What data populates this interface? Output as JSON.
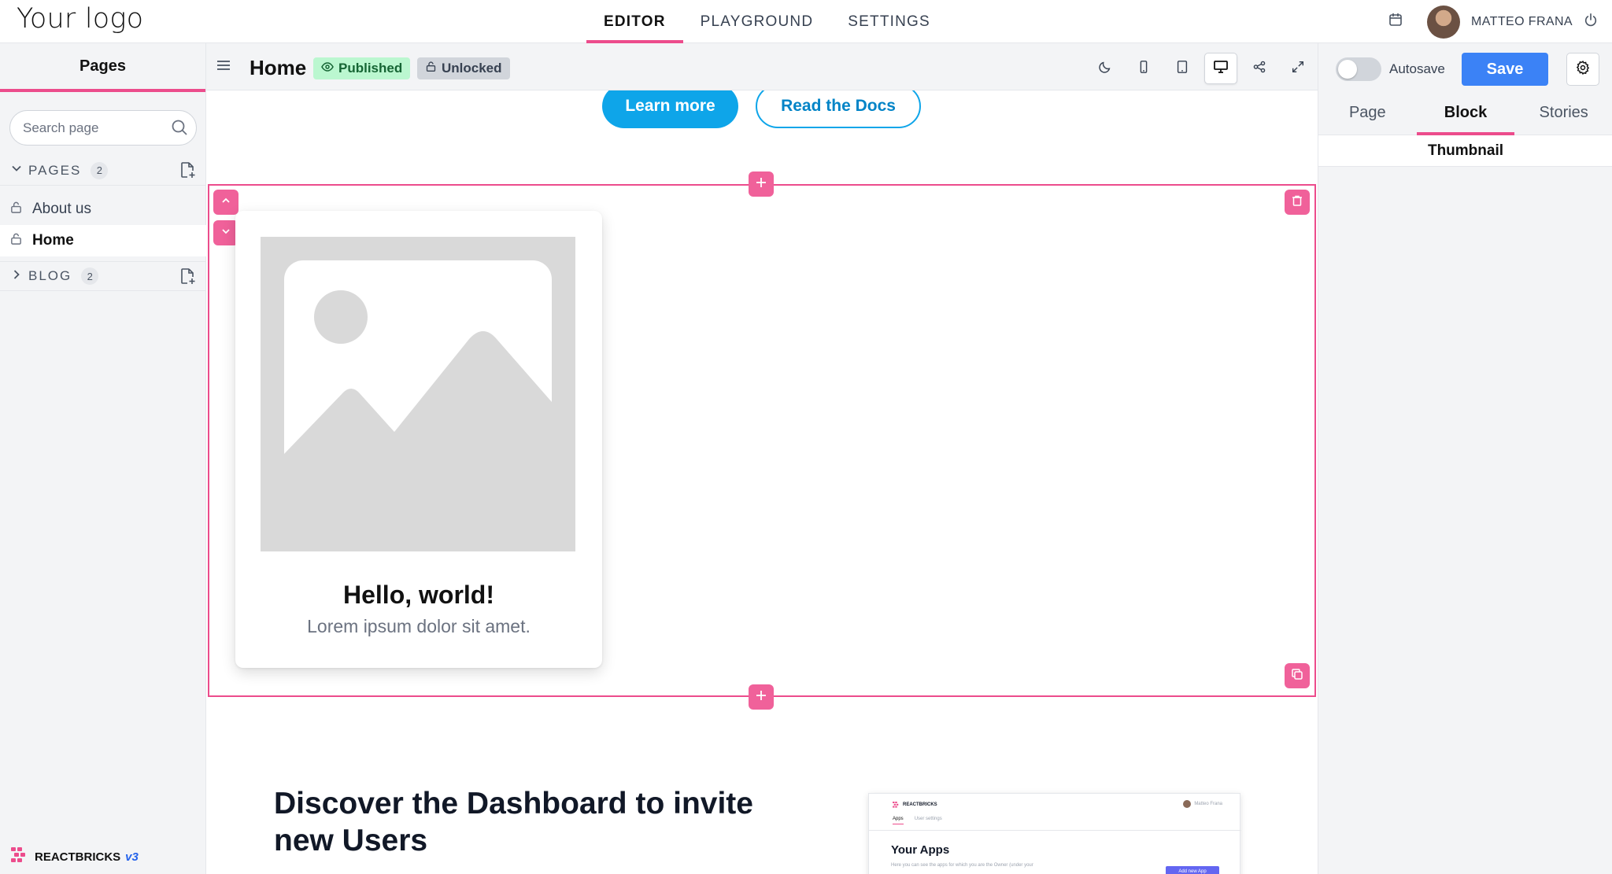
{
  "header": {
    "logo": "Your logo",
    "tabs": [
      {
        "label": "EDITOR",
        "active": true
      },
      {
        "label": "PLAYGROUND",
        "active": false
      },
      {
        "label": "SETTINGS",
        "active": false
      }
    ],
    "user_name": "MATTEO FRANA"
  },
  "sidebar": {
    "title": "Pages",
    "search_placeholder": "Search page",
    "groups": [
      {
        "label": "PAGES",
        "count": "2",
        "expanded": true,
        "items": [
          {
            "label": "About us",
            "active": false
          },
          {
            "label": "Home",
            "active": true
          }
        ]
      },
      {
        "label": "BLOG",
        "count": "2",
        "expanded": false
      }
    ],
    "brand": {
      "name": "REACTBRICKS",
      "version": "v3"
    }
  },
  "toolbar": {
    "page_title": "Home",
    "status": "Published",
    "lock": "Unlocked",
    "icons": [
      "moon-icon",
      "mobile-icon",
      "tablet-icon",
      "desktop-icon",
      "share-icon",
      "expand-icon"
    ],
    "active_device": "desktop"
  },
  "canvas": {
    "learn_more": "Learn more",
    "read_docs": "Read the Docs",
    "card_title": "Hello, world!",
    "card_text": "Lorem ipsum dolor sit amet.",
    "discover_title": "Discover the Dashboard to invite new Users",
    "screenshot": {
      "brand": "REACTBRICKS",
      "user": "Matteo Frana",
      "tabs": [
        "Apps",
        "User settings"
      ],
      "heading": "Your Apps",
      "text": "Here you can see the apps for which you are the Owner (under your",
      "button": "Add new App"
    }
  },
  "rightpanel": {
    "autosave_label": "Autosave",
    "autosave_on": false,
    "save_label": "Save",
    "tabs": [
      {
        "label": "Page",
        "active": false
      },
      {
        "label": "Block",
        "active": true
      },
      {
        "label": "Stories",
        "active": false
      }
    ],
    "section_title": "Thumbnail"
  },
  "colors": {
    "accent": "#ec4c8c",
    "primary": "#3b82f6",
    "cta": "#0ea5e9",
    "published_bg": "#bbf7d0"
  }
}
